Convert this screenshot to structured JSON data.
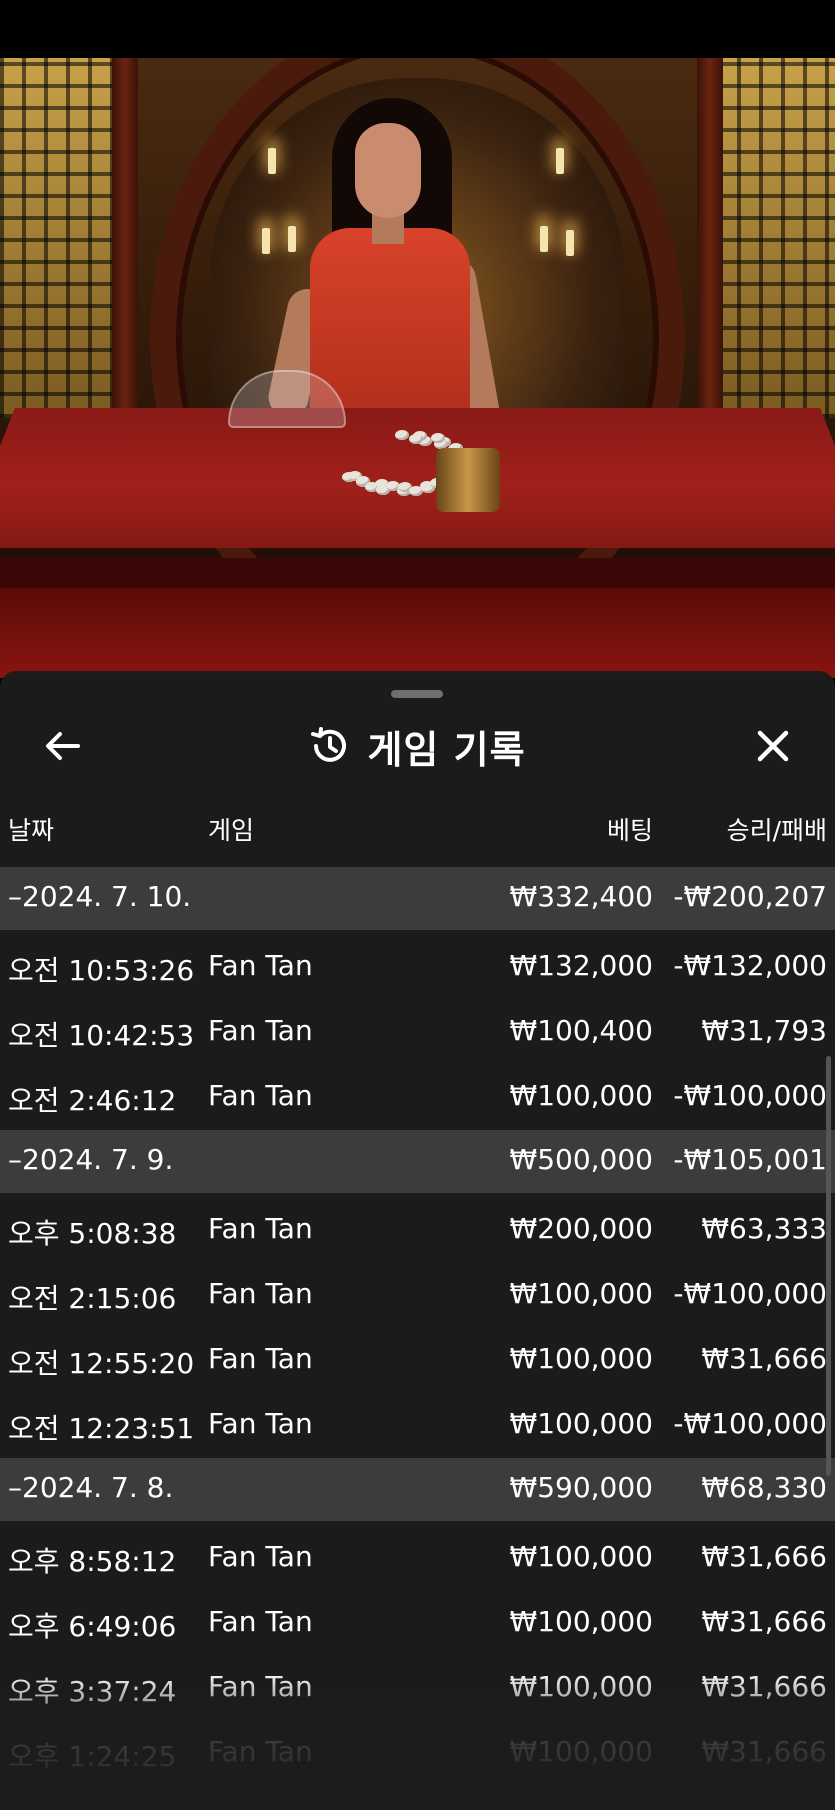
{
  "sheet": {
    "title": "게임 기록",
    "columns": {
      "date": "날짜",
      "game": "게임",
      "bet": "베팅",
      "win_loss": "승리/패배"
    },
    "groups": [
      {
        "date": "–2024. 7. 10.",
        "bet": "₩332,400",
        "win_loss": "-₩200,207",
        "rows": [
          {
            "time": "오전 10:53:26",
            "game": "Fan Tan",
            "bet": "₩132,000",
            "win_loss": "-₩132,000"
          },
          {
            "time": "오전 10:42:53",
            "game": "Fan Tan",
            "bet": "₩100,400",
            "win_loss": "₩31,793"
          },
          {
            "time": "오전 2:46:12",
            "game": "Fan Tan",
            "bet": "₩100,000",
            "win_loss": "-₩100,000"
          }
        ]
      },
      {
        "date": "–2024. 7. 9.",
        "bet": "₩500,000",
        "win_loss": "-₩105,001",
        "rows": [
          {
            "time": "오후 5:08:38",
            "game": "Fan Tan",
            "bet": "₩200,000",
            "win_loss": "₩63,333"
          },
          {
            "time": "오전 2:15:06",
            "game": "Fan Tan",
            "bet": "₩100,000",
            "win_loss": "-₩100,000"
          },
          {
            "time": "오전 12:55:20",
            "game": "Fan Tan",
            "bet": "₩100,000",
            "win_loss": "₩31,666"
          },
          {
            "time": "오전 12:23:51",
            "game": "Fan Tan",
            "bet": "₩100,000",
            "win_loss": "-₩100,000"
          }
        ]
      },
      {
        "date": "–2024. 7. 8.",
        "bet": "₩590,000",
        "win_loss": "₩68,330",
        "rows": [
          {
            "time": "오후 8:58:12",
            "game": "Fan Tan",
            "bet": "₩100,000",
            "win_loss": "₩31,666"
          },
          {
            "time": "오후 6:49:06",
            "game": "Fan Tan",
            "bet": "₩100,000",
            "win_loss": "₩31,666"
          },
          {
            "time": "오후 3:37:24",
            "game": "Fan Tan",
            "bet": "₩100,000",
            "win_loss": "₩31,666"
          },
          {
            "time": "오후 1:24:25",
            "game": "Fan Tan",
            "bet": "₩100,000",
            "win_loss": "₩31,666"
          }
        ]
      }
    ]
  },
  "icons": {
    "back": "arrow-left-icon",
    "history": "history-clock-icon",
    "close": "close-icon"
  },
  "colors": {
    "sheet_bg": "#1c1c1c",
    "group_row_bg": "#3c3c3c",
    "text": "#ffffff"
  }
}
